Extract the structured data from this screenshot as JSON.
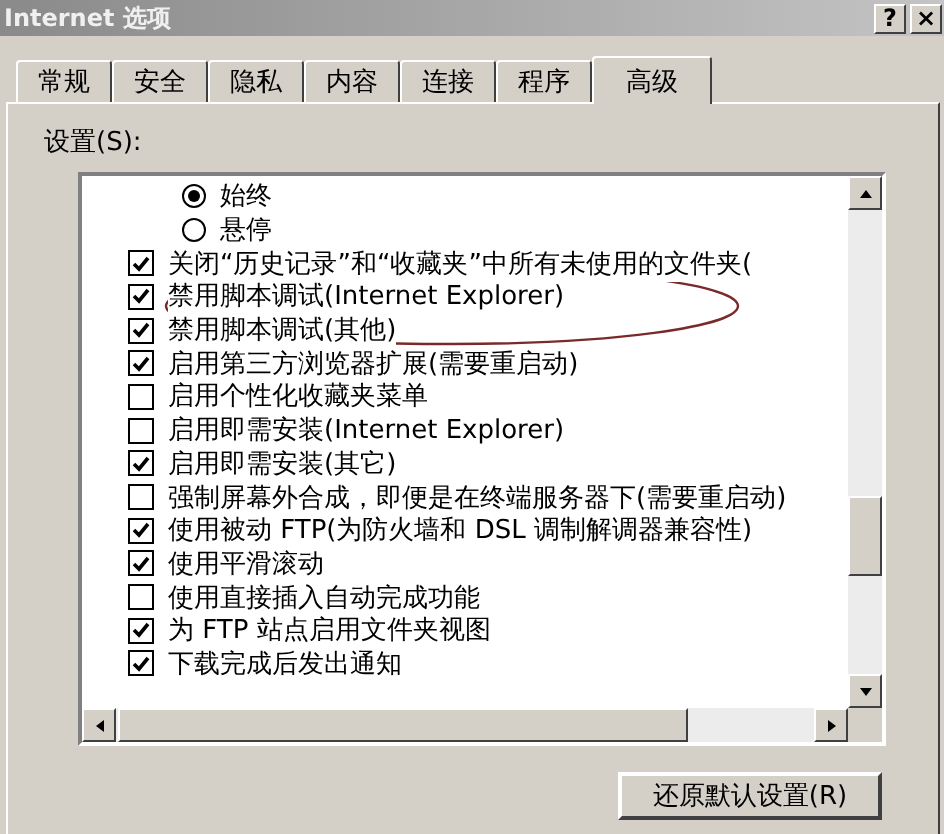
{
  "window": {
    "title": "Internet 选项",
    "buttons": [
      "?",
      "×"
    ]
  },
  "tabs": [
    {
      "label": "常规",
      "selected": false
    },
    {
      "label": "安全",
      "selected": false
    },
    {
      "label": "隐私",
      "selected": false
    },
    {
      "label": "内容",
      "selected": false
    },
    {
      "label": "连接",
      "selected": false
    },
    {
      "label": "程序",
      "selected": false
    },
    {
      "label": "高级",
      "selected": true
    }
  ],
  "settings": {
    "label": "设置(S):",
    "items": [
      {
        "kind": "radio",
        "label": "始终",
        "selected": true
      },
      {
        "kind": "radio",
        "label": "悬停",
        "selected": false
      },
      {
        "kind": "checkbox",
        "label": "关闭“历史记录”和“收藏夹”中所有未使用的文件夹(",
        "checked": true
      },
      {
        "kind": "checkbox",
        "label": "禁用脚本调试(Internet Explorer)",
        "checked": true
      },
      {
        "kind": "checkbox",
        "label": "禁用脚本调试(其他)",
        "checked": true
      },
      {
        "kind": "checkbox",
        "label": "启用第三方浏览器扩展(需要重启动)",
        "checked": true
      },
      {
        "kind": "checkbox",
        "label": "启用个性化收藏夹菜单",
        "checked": false
      },
      {
        "kind": "checkbox",
        "label": "启用即需安装(Internet Explorer)",
        "checked": false
      },
      {
        "kind": "checkbox",
        "label": "启用即需安装(其它)",
        "checked": true
      },
      {
        "kind": "checkbox",
        "label": "强制屏幕外合成，即便是在终端服务器下(需要重启动)",
        "checked": false
      },
      {
        "kind": "checkbox",
        "label": "使用被动 FTP(为防火墙和 DSL 调制解调器兼容性)",
        "checked": true
      },
      {
        "kind": "checkbox",
        "label": "使用平滑滚动",
        "checked": true
      },
      {
        "kind": "checkbox",
        "label": "使用直接插入自动完成功能",
        "checked": false
      },
      {
        "kind": "checkbox",
        "label": "为 FTP 站点启用文件夹视图",
        "checked": true
      },
      {
        "kind": "checkbox",
        "label": "下载完成后发出通知",
        "checked": true
      }
    ]
  },
  "restore_button": "还原默认设置(R)"
}
